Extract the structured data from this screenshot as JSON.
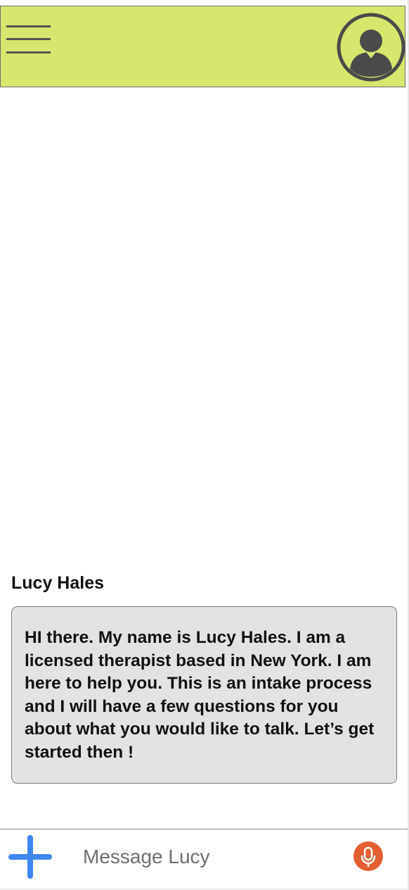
{
  "header": {
    "background_color": "#d7e66d",
    "menu_icon": "hamburger-menu-icon",
    "profile_icon": "user-profile-icon"
  },
  "conversation": {
    "sender_name": "Lucy Hales",
    "message": "HI there. My name is Lucy Hales. I am a licensed therapist based in New York. I am here to help you. This is an intake process and I will have a few questions for you about what you would like to talk. Let’s get started then !"
  },
  "composer": {
    "add_icon": "plus-icon",
    "add_icon_color": "#3f86f0",
    "placeholder": "Message Lucy",
    "mic_icon": "microphone-icon",
    "mic_color": "#e35e30"
  }
}
